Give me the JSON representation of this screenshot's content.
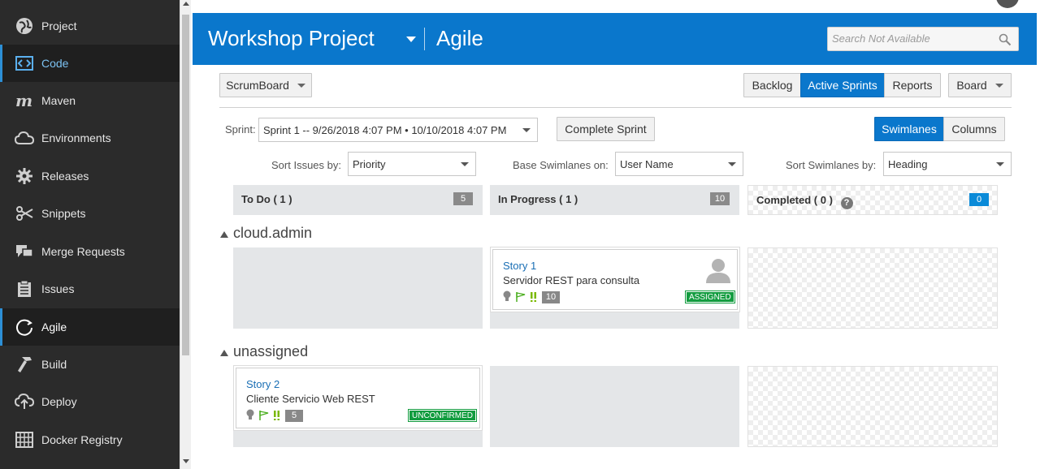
{
  "sidebar": {
    "items": [
      {
        "label": "Project",
        "icon": "globe-icon"
      },
      {
        "label": "Code",
        "icon": "code-icon"
      },
      {
        "label": "Maven",
        "icon": "maven-icon"
      },
      {
        "label": "Environments",
        "icon": "cloud-icon"
      },
      {
        "label": "Releases",
        "icon": "gear-icon"
      },
      {
        "label": "Snippets",
        "icon": "scissors-icon"
      },
      {
        "label": "Merge Requests",
        "icon": "merge-icon"
      },
      {
        "label": "Issues",
        "icon": "issues-icon"
      },
      {
        "label": "Agile",
        "icon": "agile-icon"
      },
      {
        "label": "Build",
        "icon": "hammer-icon"
      },
      {
        "label": "Deploy",
        "icon": "cloud-upload-icon"
      },
      {
        "label": "Docker Registry",
        "icon": "docker-icon"
      }
    ]
  },
  "header": {
    "project_name": "Workshop Project",
    "section": "Agile",
    "search_placeholder": "Search Not Available"
  },
  "toolbar": {
    "board_select": "ScrumBoard",
    "tabs": [
      "Backlog",
      "Active Sprints",
      "Reports"
    ],
    "active_tab": "Active Sprints",
    "board_menu": "Board"
  },
  "sprint": {
    "label": "Sprint:",
    "value": "Sprint 1 -- 9/26/2018 4:07 PM • 10/10/2018 4:07 PM",
    "complete_button": "Complete Sprint",
    "view_toggle": [
      "Swimlanes",
      "Columns"
    ],
    "active_view": "Swimlanes"
  },
  "filters": {
    "sort_issues_label": "Sort Issues by:",
    "sort_issues_value": "Priority",
    "base_swimlanes_label": "Base Swimlanes on:",
    "base_swimlanes_value": "User Name",
    "sort_swimlanes_label": "Sort Swimlanes by:",
    "sort_swimlanes_value": "Heading"
  },
  "columns": [
    {
      "title": "To Do ( 1 )",
      "count": "5"
    },
    {
      "title": "In Progress ( 1 )",
      "count": "10"
    },
    {
      "title": "Completed ( 0 )",
      "count": "0",
      "help": "?"
    }
  ],
  "swimlanes": [
    {
      "name": "cloud.admin",
      "card": {
        "title": "Story 1",
        "description": "Servidor REST para consulta",
        "points": "10",
        "status": "ASSIGNED"
      }
    },
    {
      "name": "unassigned",
      "card": {
        "title": "Story 2",
        "description": "Cliente Servicio Web REST",
        "points": "5",
        "status": "UNCONFIRMED"
      }
    }
  ],
  "colors": {
    "accent": "#0a77cc",
    "sidebar_bg": "#2b2b2b",
    "status_green": "#129c3f",
    "link_blue": "#1a6fb5"
  }
}
